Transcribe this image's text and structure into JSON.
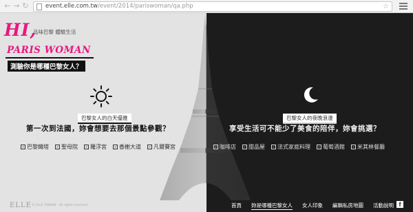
{
  "browser": {
    "url_host": "event.elle.com.tw",
    "url_path": "/event/2014/pariswoman/qa.php",
    "back_icon": "arrow-left-icon",
    "forward_icon": "arrow-right-icon",
    "star_icon": "star-icon",
    "menu_icon": "hamburger-menu-icon"
  },
  "logo": {
    "hi": "HI,",
    "tagline": "品味巴黎 體驗生活",
    "paris_woman": "PARIS WOMAN",
    "brand_color": "#e8187f"
  },
  "quiz_title": "測驗你是哪種巴黎女人？",
  "left": {
    "icon": "sun-icon",
    "tag": "巴黎女人的白天優雅",
    "question": "第一次到法國，妳會想要去那個景點參觀？",
    "options": [
      "巴黎鐵塔",
      "聖母院",
      "羅浮宮",
      "香榭大道",
      "凡爾賽宮"
    ]
  },
  "right": {
    "icon": "crescent-moon-icon",
    "tag": "巴黎女人的夜晚浪漫",
    "question": "享受生活可不能少了美食的陪伴，妳會挑選？",
    "options": [
      "咖啡店",
      "甜品屋",
      "法式家庭料理",
      "葡萄酒館",
      "米其林餐廳"
    ]
  },
  "footer": {
    "elle": "ELLE",
    "copyright": "© ELLE TAIWAN · All rights reserved",
    "nav": [
      "首頁",
      "妳是哪種巴黎女人",
      "女人印象",
      "編輯私房地圖",
      "活動說明"
    ],
    "active_index": 1,
    "fb_icon": "facebook-icon"
  }
}
